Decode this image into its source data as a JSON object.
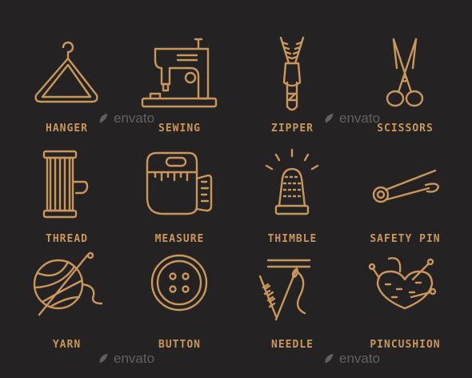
{
  "icons": [
    {
      "label": "HANGER",
      "icon": "hanger-icon"
    },
    {
      "label": "SEWING",
      "icon": "sewing-machine-icon"
    },
    {
      "label": "ZIPPER",
      "icon": "zipper-icon"
    },
    {
      "label": "SCISSORS",
      "icon": "scissors-icon"
    },
    {
      "label": "THREAD",
      "icon": "thread-spool-icon"
    },
    {
      "label": "MEASURE",
      "icon": "measuring-tape-icon"
    },
    {
      "label": "THIMBLE",
      "icon": "thimble-icon"
    },
    {
      "label": "SAFETY PIN",
      "icon": "safety-pin-icon"
    },
    {
      "label": "YARN",
      "icon": "yarn-ball-icon"
    },
    {
      "label": "BUTTON",
      "icon": "button-icon"
    },
    {
      "label": "NEEDLE",
      "icon": "needle-icon"
    },
    {
      "label": "PINCUSHION",
      "icon": "pincushion-icon"
    }
  ],
  "watermark": {
    "text": "envato",
    "icon": "envato-leaf-icon"
  },
  "colors": {
    "background": "#252224",
    "icon_stroke": "#c9975a",
    "watermark": "#6f6a6b"
  }
}
